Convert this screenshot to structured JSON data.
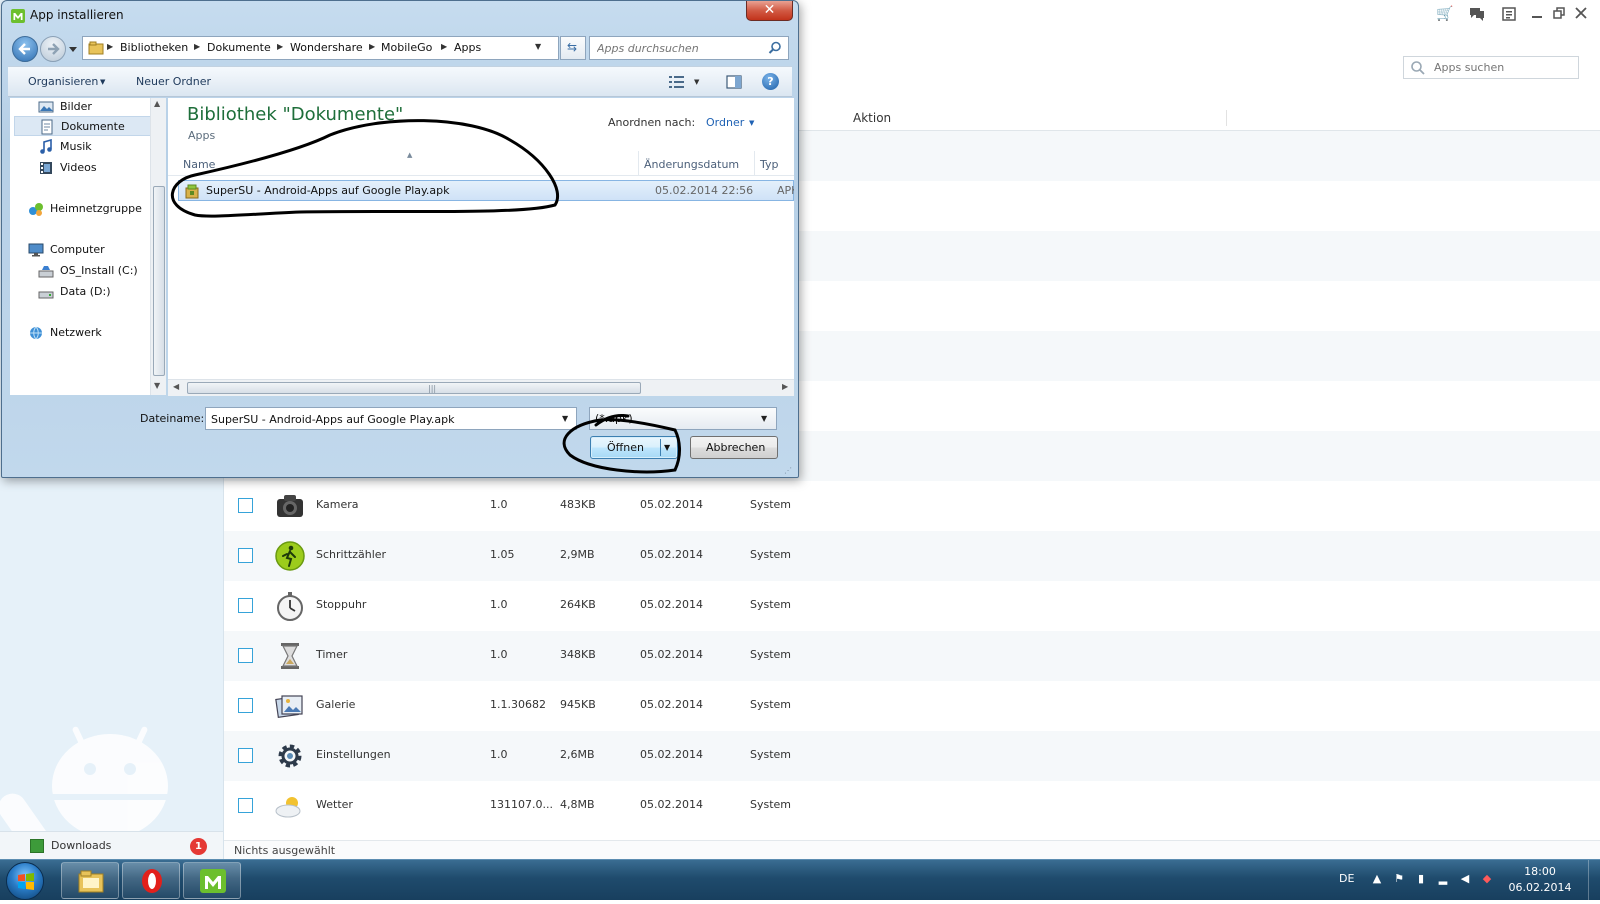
{
  "app": {
    "search_placeholder": "Apps suchen",
    "column_action": "Aktion",
    "status": "Nichts ausgewählt",
    "downloads_label": "Downloads",
    "downloads_badge": "1",
    "rows": [
      {
        "name": "Kamera",
        "version": "1.0",
        "size": "483KB",
        "date": "05.02.2014",
        "type": "System",
        "icon": "camera-icon"
      },
      {
        "name": "Schrittzähler",
        "version": "1.05",
        "size": "2,9MB",
        "date": "05.02.2014",
        "type": "System",
        "icon": "pedometer-icon"
      },
      {
        "name": "Stoppuhr",
        "version": "1.0",
        "size": "264KB",
        "date": "05.02.2014",
        "type": "System",
        "icon": "stopwatch-icon"
      },
      {
        "name": "Timer",
        "version": "1.0",
        "size": "348KB",
        "date": "05.02.2014",
        "type": "System",
        "icon": "hourglass-icon"
      },
      {
        "name": "Galerie",
        "version": "1.1.30682",
        "size": "945KB",
        "date": "05.02.2014",
        "type": "System",
        "icon": "gallery-icon"
      },
      {
        "name": "Einstellungen",
        "version": "1.0",
        "size": "2,6MB",
        "date": "05.02.2014",
        "type": "System",
        "icon": "settings-gear-icon"
      },
      {
        "name": "Wetter",
        "version": "131107.0...",
        "size": "4,8MB",
        "date": "05.02.2014",
        "type": "System",
        "icon": "weather-icon"
      }
    ]
  },
  "dialog": {
    "title": "App installieren",
    "close_glyph": "✕",
    "breadcrumb": [
      "Bibliotheken",
      "Dokumente",
      "Wondershare",
      "MobileGo",
      "Apps"
    ],
    "search_placeholder": "Apps durchsuchen",
    "toolbar": {
      "organize": "Organisieren",
      "new_folder": "Neuer Ordner",
      "help": "?"
    },
    "nav": {
      "bilder": "Bilder",
      "dokumente": "Dokumente",
      "musik": "Musik",
      "videos": "Videos",
      "heimnetzgruppe": "Heimnetzgruppe",
      "computer": "Computer",
      "os_install": "OS_Install (C:)",
      "data": "Data (D:)",
      "netzwerk": "Netzwerk"
    },
    "library_title": "Bibliothek \"Dokumente\"",
    "library_subtitle": "Apps",
    "arrange_label": "Anordnen nach:",
    "arrange_value": "Ordner",
    "columns": {
      "name": "Name",
      "modified": "Änderungsdatum",
      "type": "Typ"
    },
    "file": {
      "name": "SuperSU - Android-Apps auf Google Play.apk",
      "date": "05.02.2014 22:56",
      "type": "APK"
    },
    "filename_label": "Dateiname:",
    "filename_value": "SuperSU - Android-Apps auf Google Play.apk",
    "filter_value": "(*.apk)",
    "open_label": "Öffnen",
    "cancel_label": "Abbrechen"
  },
  "taskbar": {
    "language": "DE",
    "time": "18:00",
    "date": "06.02.2014"
  },
  "colors": {
    "accent_blue": "#36a3d9",
    "library_title_green": "#1e6e3a",
    "annotation": "#000000"
  }
}
